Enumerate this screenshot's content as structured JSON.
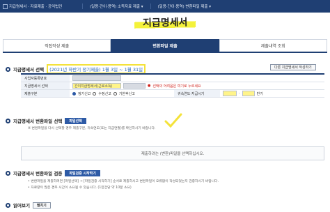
{
  "topbar": {
    "breadcrumb": "지급명세서 · 자료제출 · 공익법인",
    "links": [
      "(일용·간이·용역) 소득자료 제출",
      "(일용·간이·용역) 변환파일 제출"
    ]
  },
  "page_title": "지급명세서",
  "tabs": [
    {
      "label": "직접작성 제출",
      "active": false
    },
    {
      "label": "변환파일 제출",
      "active": true
    },
    {
      "label": "제출내역 조회",
      "active": false
    }
  ],
  "select_section": {
    "title": "지급명세서 선택",
    "period_text": "(2021년 하반기 정기제출) 1월 3일 ~ 1월 31일",
    "other_button": "다른 지급명세서 작성하기"
  },
  "form": {
    "rows": [
      {
        "label": "사업자등록번호",
        "value": ""
      },
      {
        "label": "지급명세서 선택",
        "value": "간이지급명세서(근로소득)",
        "note": "선택의 어려움은 여기로 누르세요"
      },
      {
        "label": "제출구분",
        "options": [
          "정기신고",
          "수정신고",
          "기한후신고"
        ],
        "selected": 0,
        "right_label": "귀속연도·지급시기",
        "right_suffix": "반기"
      }
    ]
  },
  "convert_section": {
    "title": "지급명세서 변환파일 선택",
    "select_button": "파일선택",
    "note": "※ 변환파일을 다시 선택할 경우 제출구분, 귀속연도(또는 지급연월)를 확인하시기 바랍니다.",
    "dropzone_text": "제출하려는 (변환)파일을 선택하십시오."
  },
  "verify_section": {
    "title": "지급명세서 변환파일 검증",
    "verify_button": "파일검증 시작하기",
    "notes": [
      "• 변환파일을 제출하려면 [파일선택] → [파일검증 시작하기] 순서로 제출하시고 변환파일이 오류없이 작성되었는지 검증하시기 바랍니다.",
      "• 자료량이 많은 경우 시간이 소요될 수 있습니다. (1만건당 약 10분 소요)"
    ]
  },
  "read_section": {
    "title": "읽어보기",
    "toggle_button": "펼치기"
  },
  "colors": {
    "navy": "#1f3f73",
    "highlight": "#f4e23a",
    "error": "#d0211b"
  }
}
